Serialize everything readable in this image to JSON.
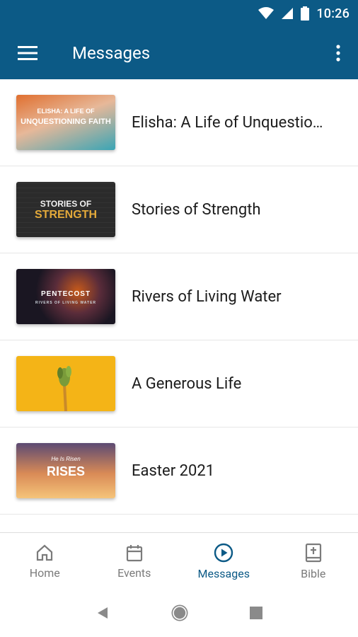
{
  "status_bar": {
    "time": "10:26"
  },
  "app_bar": {
    "title": "Messages"
  },
  "messages": [
    {
      "title": "Elisha: A Life of Unquestioning Faith",
      "display": "Elisha: A Life of Unquestio…",
      "thumb_lines": [
        "ELISHA: A LIFE OF",
        "UNQUESTIONING FAITH"
      ],
      "thumb_bg": "#e7b899"
    },
    {
      "title": "Stories of Strength",
      "display": "Stories of Strength",
      "thumb_lines": [
        "STORIES OF",
        "STRENGTH"
      ],
      "thumb_bg": "#2c2c2c"
    },
    {
      "title": "Rivers of Living Water",
      "display": "Rivers of Living Water",
      "thumb_lines": [
        "PENTECOST",
        "RIVERS OF LIVING WATER"
      ],
      "thumb_bg": "#1a1622"
    },
    {
      "title": "A Generous Life",
      "display": "A Generous Life",
      "thumb_lines": [
        "",
        ""
      ],
      "thumb_bg": "#f4b417"
    },
    {
      "title": "Easter 2021",
      "display": "Easter 2021",
      "thumb_lines": [
        "He Is Risen",
        "RISES"
      ],
      "thumb_bg": "#5c4a73"
    }
  ],
  "tabs": [
    {
      "label": "Home",
      "icon": "home-icon",
      "active": false
    },
    {
      "label": "Events",
      "icon": "calendar-icon",
      "active": false
    },
    {
      "label": "Messages",
      "icon": "play-circle-icon",
      "active": true
    },
    {
      "label": "Bible",
      "icon": "bible-icon",
      "active": false
    }
  ],
  "colors": {
    "primary": "#0c5a86",
    "inactive": "#7b7b7b"
  }
}
